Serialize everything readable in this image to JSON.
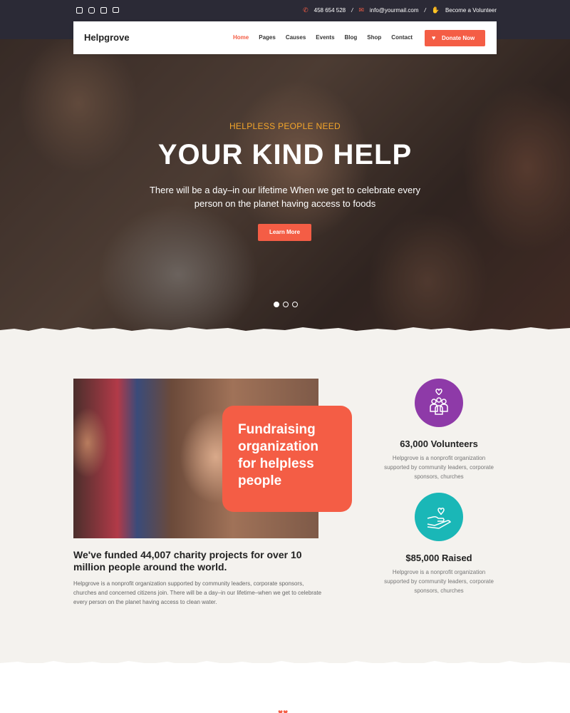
{
  "topbar": {
    "social_icons": [
      "facebook-icon",
      "instagram-icon",
      "twitter-icon",
      "youtube-icon"
    ],
    "phone": "458 654 528",
    "email": "info@yourmail.com",
    "volunteer": "Become a Volunteer"
  },
  "nav": {
    "logo": "Helpgrove",
    "items": [
      "Home",
      "Pages",
      "Causes",
      "Events",
      "Blog",
      "Shop",
      "Contact"
    ],
    "active": "Home",
    "donate_label": "Donate Now"
  },
  "hero": {
    "kicker": "HELPLESS PEOPLE NEED",
    "title": "YOUR KIND HELP",
    "description": "There will be a day–in our lifetime When we get to celebrate every person on the planet having access to foods",
    "button": "Learn More",
    "slides": 3,
    "active_slide": 1
  },
  "about": {
    "card_text": "Fundraising organization for helpless people",
    "headline": "We've funded 44,007 charity projects for over 10 million people around the world.",
    "description": "Helpgrove is a nonprofit organization supported by community leaders, corporate sponsors, churches and concerned citizens join. There will be a day–in our lifetime–when we get to celebrate every person on the planet having access to clean water."
  },
  "stats": [
    {
      "icon": "volunteers-icon",
      "color": "#8e3aa8",
      "title": "63,000 Volunteers",
      "description": "Helpgrove is a nonprofit organization supported by community leaders, corporate sponsors, churches"
    },
    {
      "icon": "heart-hand-icon",
      "color": "#1ab7b7",
      "title": "$85,000 Raised",
      "description": "Helpgrove is a nonprofit organization supported by community leaders, corporate sponsors, churches"
    }
  ],
  "colors": {
    "accent": "#f45d45",
    "topbar": "#2b2a36",
    "kicker": "#f4a62a",
    "background": "#f4f2ee"
  }
}
